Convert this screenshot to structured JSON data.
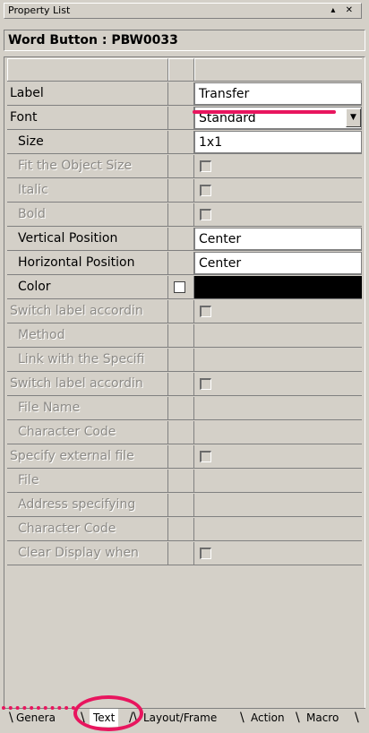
{
  "window": {
    "title": "Property List",
    "controls": "▴ ✕"
  },
  "heading": "Word Button : PBW0033",
  "rows": [
    {
      "label": "Label",
      "value": "Transfer",
      "style": "text"
    },
    {
      "label": "Font",
      "value": "Standard",
      "style": "dropdown"
    },
    {
      "label": "Size",
      "value": "1x1",
      "style": "text"
    },
    {
      "label": "Fit the Object Size",
      "style": "checkbox"
    },
    {
      "label": "Italic",
      "style": "checkbox"
    },
    {
      "label": "Bold",
      "style": "checkbox"
    },
    {
      "label": "Vertical Position",
      "value": "Center",
      "style": "text"
    },
    {
      "label": "Horizontal Position",
      "value": "Center",
      "style": "text"
    },
    {
      "label": "Color",
      "style": "color"
    },
    {
      "label": "Switch label accordin",
      "style": "checkbox"
    },
    {
      "label": "Method",
      "style": "empty"
    },
    {
      "label": "Link with the Specifi",
      "style": "empty"
    },
    {
      "label": "Switch label accordin",
      "style": "checkbox"
    },
    {
      "label": "File Name",
      "style": "empty"
    },
    {
      "label": "Character Code",
      "style": "empty"
    },
    {
      "label": "Specify external file",
      "style": "checkbox"
    },
    {
      "label": "File",
      "style": "empty"
    },
    {
      "label": "Address specifying",
      "style": "empty"
    },
    {
      "label": "Character Code",
      "style": "empty"
    },
    {
      "label": "Clear Display when",
      "style": "checkbox"
    }
  ],
  "tabs": [
    "Genera",
    "Text",
    "Layout/Frame",
    "Action",
    "Macro"
  ],
  "selected_tab": "Text",
  "colors": {
    "annotation": "#e8155e",
    "color_value": "#000000"
  }
}
